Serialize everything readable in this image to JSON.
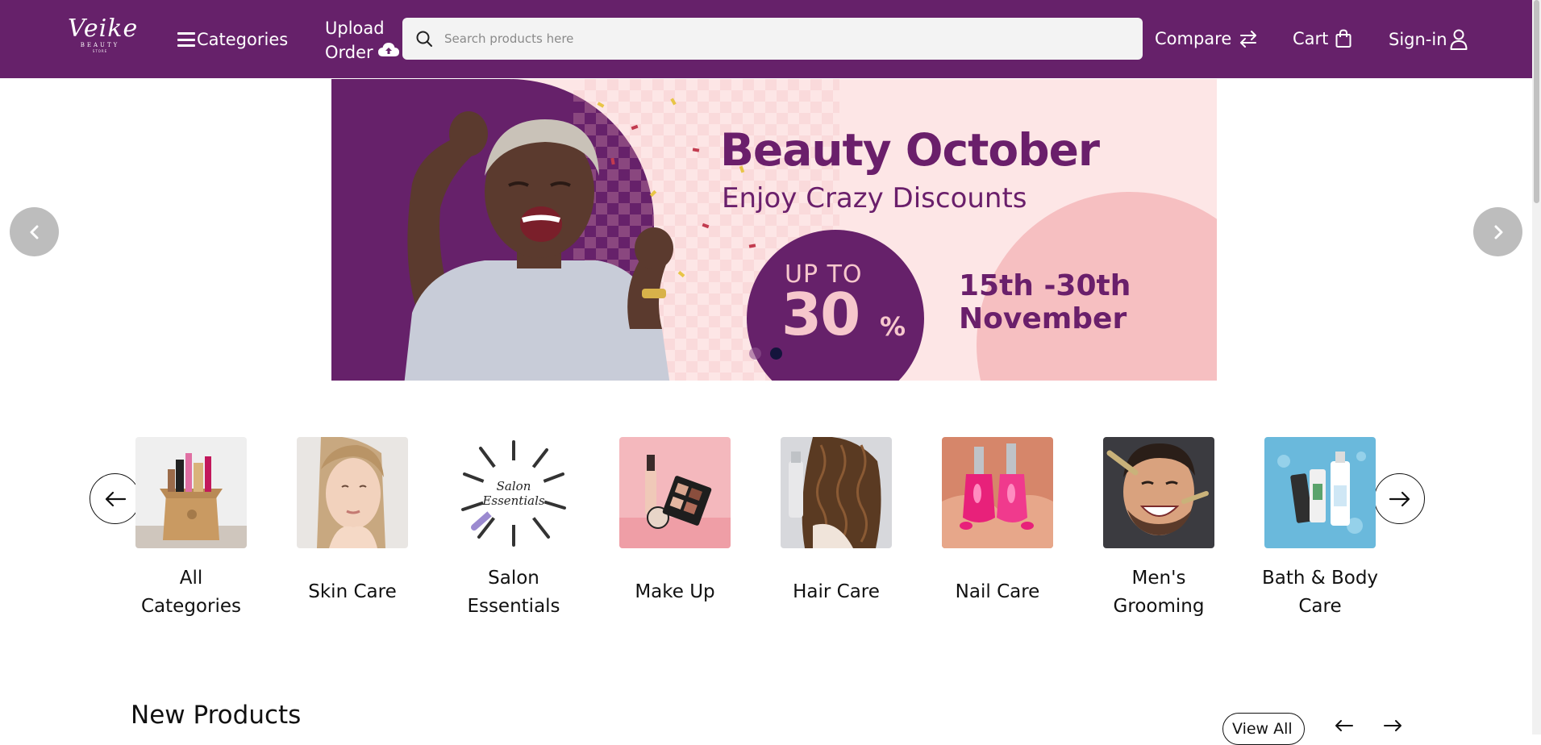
{
  "header": {
    "logo": {
      "word": "Veike",
      "sub": "BEAUTY",
      "sub2": "STORE"
    },
    "categories_label": "Categories",
    "upload_label_line1": "Upload",
    "upload_label_line2": "Order",
    "search_placeholder": "Search products here",
    "compare_label": "Compare",
    "cart_label": "Cart",
    "signin_label": "Sign-in",
    "brand_color": "#66216a"
  },
  "banner": {
    "headline": "Beauty October",
    "subline": "Enjoy Crazy Discounts",
    "upto": "UP TO",
    "percent": "30",
    "percent_sign": "%",
    "dates_line1": "15th -30th",
    "dates_line2": "November",
    "active_slide": 2,
    "slide_count": 2
  },
  "categories": {
    "items": [
      {
        "line1": "All",
        "line2": "Categories",
        "icon": "gift-box-products"
      },
      {
        "line1": "Skin Care",
        "line2": "",
        "icon": "woman-face"
      },
      {
        "line1": "Salon",
        "line2": "Essentials",
        "icon": "salon-tools"
      },
      {
        "line1": "Make Up",
        "line2": "",
        "icon": "makeup-palette"
      },
      {
        "line1": "Hair Care",
        "line2": "",
        "icon": "curly-hair"
      },
      {
        "line1": "Nail Care",
        "line2": "",
        "icon": "nail-polish"
      },
      {
        "line1": "Men's",
        "line2": "Grooming",
        "icon": "man-grooming"
      },
      {
        "line1": "Bath & Body",
        "line2": "Care",
        "icon": "bath-products"
      }
    ],
    "salon_thumb_text_1": "Salon",
    "salon_thumb_text_2": "Essentials"
  },
  "new_products": {
    "title": "New Products",
    "view_all_label": "View All"
  }
}
